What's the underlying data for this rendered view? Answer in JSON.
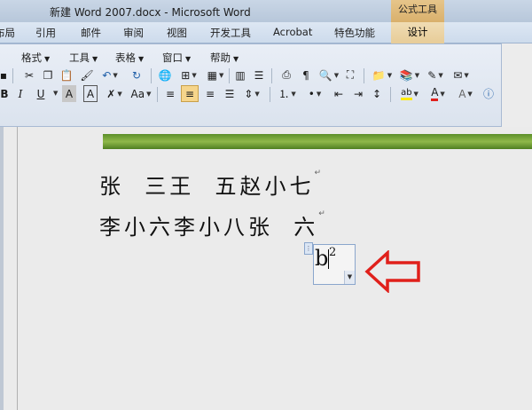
{
  "window": {
    "title": "新建 Word 2007.docx - Microsoft Word",
    "contextual_group": "公式工具"
  },
  "ribbon_tabs": [
    {
      "label": "布局"
    },
    {
      "label": "引用"
    },
    {
      "label": "邮件"
    },
    {
      "label": "审阅"
    },
    {
      "label": "视图"
    },
    {
      "label": "开发工具"
    },
    {
      "label": "Acrobat"
    },
    {
      "label": "特色功能"
    },
    {
      "label": "设计"
    }
  ],
  "menus": [
    {
      "label": "格式"
    },
    {
      "label": "工具"
    },
    {
      "label": "表格"
    },
    {
      "label": "窗口"
    },
    {
      "label": "帮助"
    }
  ],
  "toolbar": {
    "bold": "B",
    "italic": "I",
    "underline": "U",
    "char_shade": "A",
    "char_border": "A",
    "change_case": "Aa",
    "highlight": "ab",
    "font_color": "A",
    "colors": {
      "highlight": "#ffeb00",
      "font_color": "#e0201b",
      "accent": "#1f5fa8"
    }
  },
  "document": {
    "lines": [
      {
        "text": "张  三王  五赵小七"
      },
      {
        "text": "李小六李小八张  六"
      }
    ],
    "equation": {
      "base": "b",
      "superscript": "2"
    }
  },
  "annotation": {
    "arrow_color": "#e0201b"
  }
}
